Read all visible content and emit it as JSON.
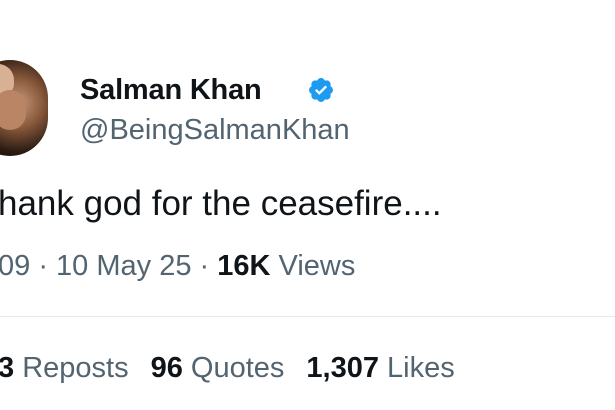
{
  "author": {
    "name": "Salman Khan",
    "handle": "@BeingSalmanKhan",
    "verified": true,
    "avatar_icon": "profile-photo",
    "verified_icon": "verified-badge-icon"
  },
  "tweet": {
    "text": "hank god for the ceasefire...."
  },
  "meta": {
    "time": "09",
    "separator1": " · ",
    "date": "10 May 25",
    "separator2": " · ",
    "views_count": "16K",
    "views_label": " Views"
  },
  "stats": {
    "reposts_count": "3",
    "reposts_label": " Reposts",
    "quotes_count": "96",
    "quotes_label": " Quotes",
    "likes_count": "1,307",
    "likes_label": " Likes"
  },
  "colors": {
    "verified_blue": "#1d9bf0",
    "secondary_text": "#536471",
    "primary_text": "#0f1419"
  }
}
